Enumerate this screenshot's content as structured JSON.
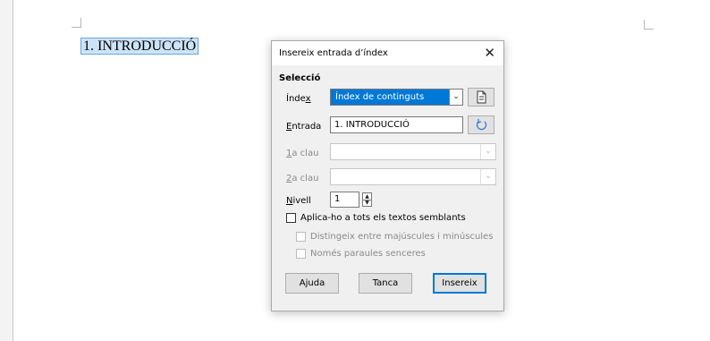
{
  "document": {
    "heading": "1. INTRODUCCIÓ"
  },
  "dialog": {
    "title": "Insereix entrada d’índex",
    "close_glyph": "✕",
    "section": "Selecció",
    "index_label": "Índex",
    "index_value": "Índex de continguts",
    "entry_label": "Entrada",
    "entry_value": "1. INTRODUCCIÓ",
    "key1_label": "1a clau",
    "key1_value": "",
    "key2_label": "2a clau",
    "key2_value": "",
    "level_label": "Nivell",
    "level_value": "1",
    "apply_all_label": "Aplica-ho a tots els textos semblants",
    "match_case_label": "Distingeix entre majúscules i minúscules",
    "whole_words_label": "Només paraules senceres",
    "help_button": "Ajuda",
    "close_button": "Tanca",
    "insert_button": "Insereix"
  },
  "colors": {
    "selection_highlight": "#cde3f7",
    "accent": "#0078d7"
  },
  "icons": {
    "new_index": "new-document-icon",
    "update": "refresh-icon",
    "dropdown": "chevron-down-icon"
  }
}
